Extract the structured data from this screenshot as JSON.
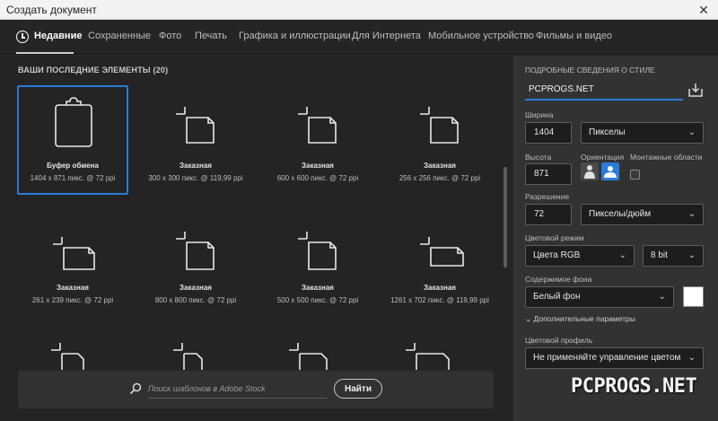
{
  "window": {
    "title": "Создать документ"
  },
  "tabs": [
    {
      "label": "Недавние"
    },
    {
      "label": "Сохраненные"
    },
    {
      "label": "Фото"
    },
    {
      "label": "Печать"
    },
    {
      "label": "Графика и иллюстрации"
    },
    {
      "label": "Для Интернета"
    },
    {
      "label": "Мобильное устройство"
    },
    {
      "label": "Фильмы и видео"
    }
  ],
  "recent": {
    "title": "ВАШИ ПОСЛЕДНИЕ ЭЛЕМЕНТЫ",
    "count": "(20)",
    "items": [
      {
        "name": "Буфер обмена",
        "size": "1404 x 871 пикс. @ 72 ppi",
        "icon": "clipboard-icon"
      },
      {
        "name": "Заказная",
        "size": "300 x 300 пикс. @ 119,99 ppi",
        "icon": "blank-document-icon"
      },
      {
        "name": "Заказная",
        "size": "600 x 600 пикс. @ 72 ppi",
        "icon": "blank-document-icon"
      },
      {
        "name": "Заказная",
        "size": "256 x 256 пикс. @ 72 ppi",
        "icon": "blank-document-icon"
      },
      {
        "name": "Заказная",
        "size": "261 x 239 пикс. @ 72 ppi",
        "icon": "blank-document-icon"
      },
      {
        "name": "Заказная",
        "size": "800 x 800 пикс. @ 72 ppi",
        "icon": "blank-document-icon"
      },
      {
        "name": "Заказная",
        "size": "500 x 500 пикс. @ 72 ppi",
        "icon": "blank-document-icon"
      },
      {
        "name": "Заказная",
        "size": "1261 x 702 пикс. @ 119,99 ppi",
        "icon": "blank-document-icon"
      }
    ]
  },
  "search": {
    "placeholder": "Поиск шаблонов в Adobe Stock",
    "button": "Найти"
  },
  "details": {
    "heading": "ПОДРОБНЫЕ СВЕДЕНИЯ О СТИЛЕ",
    "doc_name": "PCPROGS.NET",
    "width_label": "Ширина",
    "width_value": "1404",
    "width_unit": "Пикселы",
    "height_label": "Высота",
    "height_value": "871",
    "orientation_label": "Ориентация",
    "artboards_label": "Монтажные области",
    "resolution_label": "Разрешение",
    "resolution_value": "72",
    "resolution_unit": "Пикселы/дюйм",
    "color_mode_label": "Цветовой режим",
    "color_mode_value": "Цвета RGB",
    "bit_depth": "8 bit",
    "background_label": "Содержимое фона",
    "background_value": "Белый фон",
    "background_color": "#ffffff",
    "advanced_label": "Дополнительные параметры",
    "color_profile_label": "Цветовой профиль",
    "color_profile_value": "Не применяйте управление цветом"
  },
  "watermark": "PCPROGS.NET",
  "colors": {
    "accent": "#2a7bd8"
  }
}
